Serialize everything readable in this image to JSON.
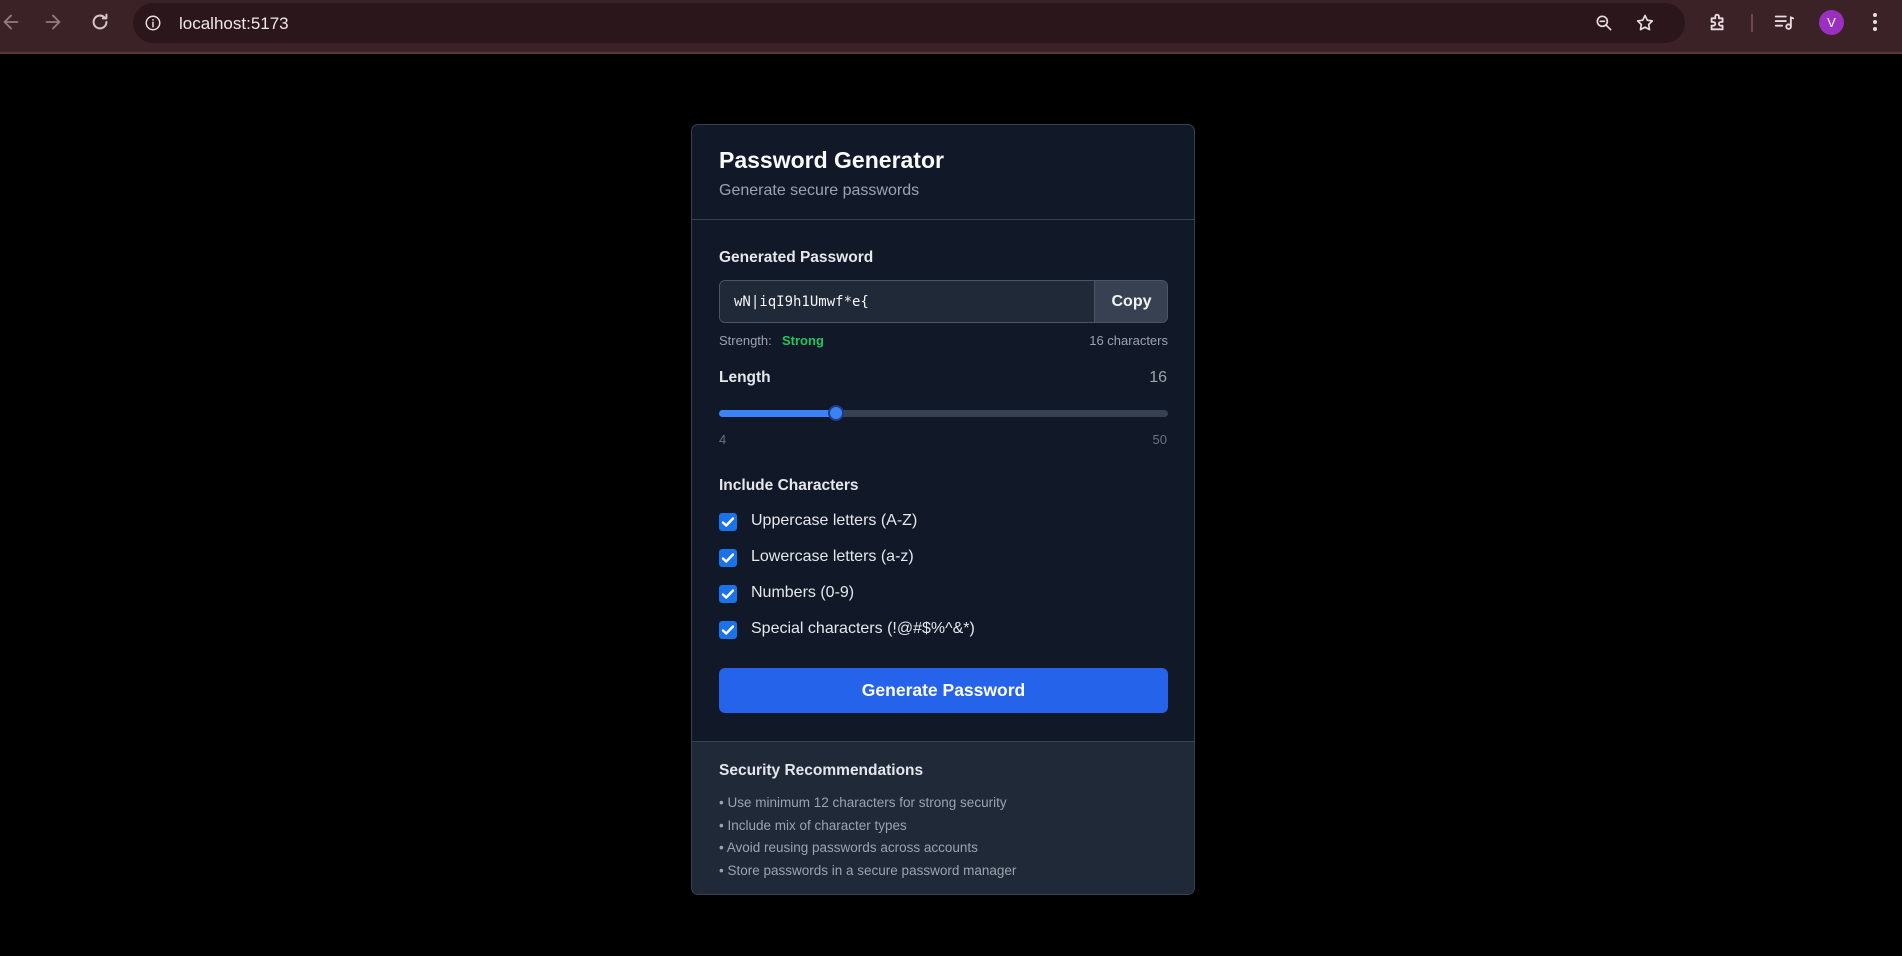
{
  "browser": {
    "url": "localhost:5173",
    "profile_initial": "V",
    "icons": {
      "back": "arrow-left-icon",
      "forward": "arrow-right-icon",
      "reload": "reload-icon",
      "site_info": "info-icon",
      "zoom": "zoom-icon",
      "bookmark": "star-icon",
      "extensions": "puzzle-icon",
      "media": "media-control-icon",
      "menu": "kebab-menu-icon"
    }
  },
  "app": {
    "title": "Password Generator",
    "subtitle": "Generate secure passwords",
    "generated": {
      "label": "Generated Password",
      "value": "wN|iqI9h1Umwf*e{",
      "copy_label": "Copy",
      "strength_label": "Strength:",
      "strength_value": "Strong",
      "char_count": "16 characters"
    },
    "length": {
      "label": "Length",
      "value": 16,
      "min": 4,
      "max": 50
    },
    "include": {
      "label": "Include Characters",
      "options": [
        {
          "label": "Uppercase letters (A-Z)",
          "checked": true
        },
        {
          "label": "Lowercase letters (a-z)",
          "checked": true
        },
        {
          "label": "Numbers (0-9)",
          "checked": true
        },
        {
          "label": "Special characters (!@#$%^&*)",
          "checked": true
        }
      ]
    },
    "generate_label": "Generate Password",
    "recommendations": {
      "title": "Security Recommendations",
      "items": [
        "• Use minimum 12 characters for strong security",
        "• Include mix of character types",
        "• Avoid reusing passwords across accounts",
        "• Store passwords in a secure password manager"
      ]
    }
  },
  "colors": {
    "page_background": "#000000",
    "card_background": "#111827",
    "accent": "#2563eb",
    "strength_strong": "#22c55e",
    "chrome_background": "#3b2227",
    "avatar": "#9b2fc0"
  }
}
